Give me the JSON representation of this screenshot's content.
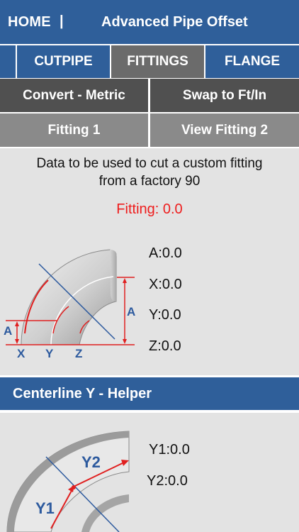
{
  "header": {
    "home_label": "HOME",
    "separator": "|",
    "title": "Advanced Pipe Offset"
  },
  "tabs": [
    {
      "label": "CUTPIPE"
    },
    {
      "label": "FITTINGS"
    },
    {
      "label": "FLANGE"
    }
  ],
  "buttons": {
    "convert": "Convert - Metric",
    "swap": "Swap to Ft/In",
    "fitting1": "Fitting 1",
    "view_fitting2": "View Fitting 2"
  },
  "description": {
    "line1": "Data to be used to cut a custom fitting",
    "line2": "from a factory 90"
  },
  "fitting_result": "Fitting: 0.0",
  "values": {
    "a": {
      "label": "A:",
      "value": "0.0"
    },
    "x": {
      "label": "X:",
      "value": "0.0"
    },
    "y": {
      "label": "Y:",
      "value": "0.0"
    },
    "z": {
      "label": "Z:",
      "value": "0.0"
    }
  },
  "diagram1_labels": {
    "a_left": "A",
    "a_right": "A",
    "x": "X",
    "y": "Y",
    "z": "Z"
  },
  "helper": {
    "title": "Centerline Y - Helper",
    "y1": {
      "label": "Y1:",
      "value": "0.0"
    },
    "y2": {
      "label": "Y2:",
      "value": "0.0"
    },
    "diagram_labels": {
      "y1": "Y1",
      "y2": "Y2"
    }
  },
  "colors": {
    "brand_blue": "#2f5f9a",
    "accent_red": "#ee1c1c",
    "diagram_blue": "#2d5a9e"
  }
}
